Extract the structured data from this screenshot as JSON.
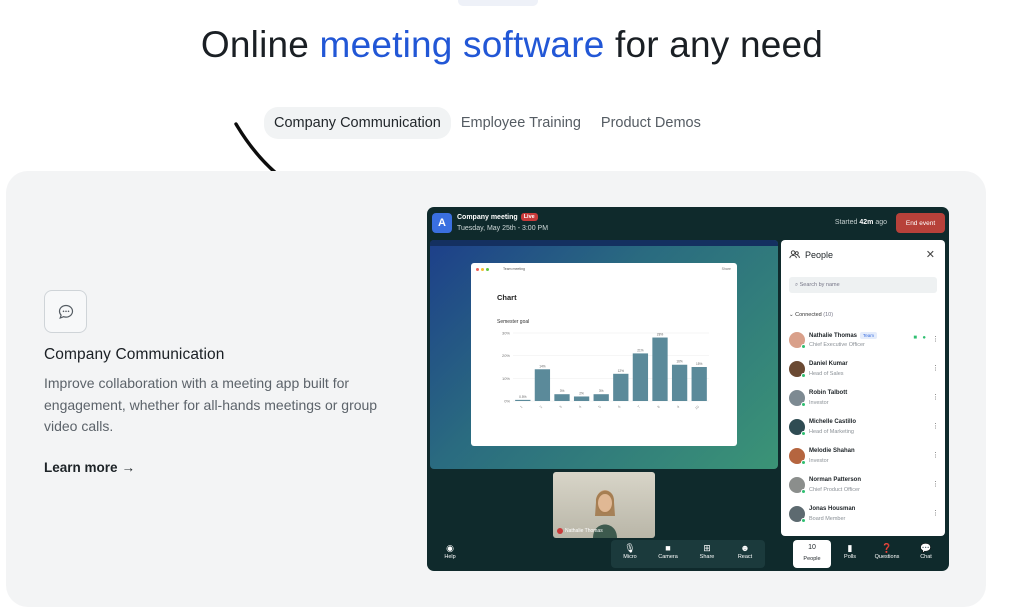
{
  "headline": {
    "pre": "Online ",
    "accent": "meeting software",
    "post": " for any need"
  },
  "tabs": [
    {
      "label": "Company Communication",
      "active": true
    },
    {
      "label": "Employee Training",
      "active": false
    },
    {
      "label": "Product Demos",
      "active": false
    }
  ],
  "feature": {
    "icon": "chat-bubble-icon",
    "title": "Company Communication",
    "description": "Improve collaboration with a meeting app built for engagement, whether for all-hands meetings or group video calls.",
    "link_label": "Learn more",
    "link_arrow": "→"
  },
  "app": {
    "logo_letter": "A",
    "meeting_title": "Company meeting",
    "live_badge": "Live",
    "meeting_time": "Tuesday, May 25th - 3:00 PM",
    "started_prefix": "Started ",
    "started_value": "42m",
    "started_suffix": " ago",
    "end_button": "End event",
    "chart_window": {
      "tab_title": "Team meeting",
      "right_label": "Share",
      "title": "Chart",
      "subtitle": "Semester goal"
    },
    "self_video_name": "Nathalie Thomas",
    "people_panel": {
      "title": "People",
      "search_placeholder": "Search by name",
      "connected_label": "Connected",
      "connected_count": "(10)",
      "people": [
        {
          "name": "Nathalie Thomas",
          "role": "Chief Executive Officer",
          "badge": "Team",
          "avatar_color": "#d9a08a"
        },
        {
          "name": "Daniel Kumar",
          "role": "Head of Sales",
          "badge": "",
          "avatar_color": "#6b4a33"
        },
        {
          "name": "Robin Talbott",
          "role": "Investor",
          "badge": "",
          "avatar_color": "#7d8a92"
        },
        {
          "name": "Michelle Castillo",
          "role": "Head of Marketing",
          "badge": "",
          "avatar_color": "#2f4c53"
        },
        {
          "name": "Melodie Shahan",
          "role": "Investor",
          "badge": "",
          "avatar_color": "#b5653f"
        },
        {
          "name": "Norman Patterson",
          "role": "Chief Product Officer",
          "badge": "",
          "avatar_color": "#8b8e8c"
        },
        {
          "name": "Jonas Housman",
          "role": "Board Member",
          "badge": "",
          "avatar_color": "#5d6a70"
        }
      ]
    },
    "toolbar": {
      "help": "Help",
      "micro": "Micro",
      "camera": "Camera",
      "share": "Share",
      "react": "React",
      "people_count": "10",
      "people": "People",
      "polls": "Polls",
      "questions": "Questions",
      "chat": "Chat"
    }
  },
  "chart_data": {
    "type": "bar",
    "title": "Chart",
    "subtitle": "Semester goal",
    "categories": [
      "1",
      "2",
      "3",
      "4",
      "5",
      "6",
      "7",
      "8",
      "9",
      "10"
    ],
    "values": [
      0.5,
      14,
      3,
      2,
      3,
      12,
      21,
      28,
      16,
      15
    ],
    "ylim": [
      0,
      30
    ],
    "yticks": [
      "0%",
      "10%",
      "20%",
      "30%"
    ],
    "color": "#5b8a9a"
  }
}
